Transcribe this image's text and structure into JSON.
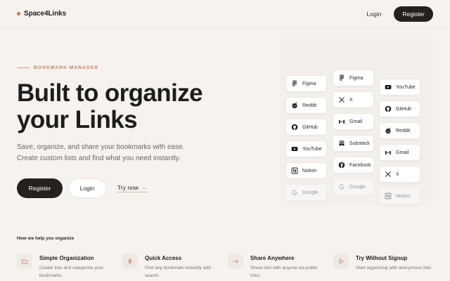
{
  "nav": {
    "brand": "Space4Links",
    "login_label": "Login",
    "register_label": "Register"
  },
  "hero": {
    "eyebrow": "BOOKMARK MANAGER",
    "title_line1": "Built to organize",
    "title_line2": "your Links",
    "subtitle_line1": "Save, organize, and share your bookmarks with ease.",
    "subtitle_line2": "Create custom lists and find what you need instantly.",
    "register_label": "Register",
    "login_label": "Login",
    "try_label": "Try now",
    "try_arrow": "→"
  },
  "cards": {
    "col1": [
      {
        "label": "Figma",
        "icon": "figma-icon"
      },
      {
        "label": "Reddit",
        "icon": "reddit-icon"
      },
      {
        "label": "GitHub",
        "icon": "github-icon"
      },
      {
        "label": "YouTube",
        "icon": "youtube-icon"
      },
      {
        "label": "Notion",
        "icon": "notion-icon"
      },
      {
        "label": "Google",
        "icon": "google-icon"
      }
    ],
    "col2": [
      {
        "label": "Figma",
        "icon": "figma-icon"
      },
      {
        "label": "X",
        "icon": "x-icon"
      },
      {
        "label": "Gmail",
        "icon": "gmail-icon"
      },
      {
        "label": "Substack",
        "icon": "substack-icon"
      },
      {
        "label": "Facebook",
        "icon": "facebook-icon"
      },
      {
        "label": "Google",
        "icon": "google-icon"
      }
    ],
    "col3": [
      {
        "label": "YouTube",
        "icon": "youtube-icon"
      },
      {
        "label": "GitHub",
        "icon": "github-icon"
      },
      {
        "label": "Reddit",
        "icon": "reddit-icon"
      },
      {
        "label": "Gmail",
        "icon": "gmail-icon"
      },
      {
        "label": "X",
        "icon": "x-icon"
      },
      {
        "label": "Notion",
        "icon": "notion-icon"
      }
    ]
  },
  "features": {
    "title": "How we help you organize",
    "items": [
      {
        "title": "Simple Organization",
        "desc": "Create lists and categorize your bookmarks.",
        "icon": "folder-icon"
      },
      {
        "title": "Quick Access",
        "desc": "Find any bookmark instantly with search.",
        "icon": "lightning-icon"
      },
      {
        "title": "Share Anywhere",
        "desc": "Share lists with anyone via public links.",
        "icon": "arrow-right-icon"
      },
      {
        "title": "Try Without Signup",
        "desc": "Start organizing with anonymous lists.",
        "icon": "play-icon"
      }
    ]
  },
  "colors": {
    "background": "#f6f3ef",
    "accent": "#c8795a",
    "dark": "#24211f"
  }
}
